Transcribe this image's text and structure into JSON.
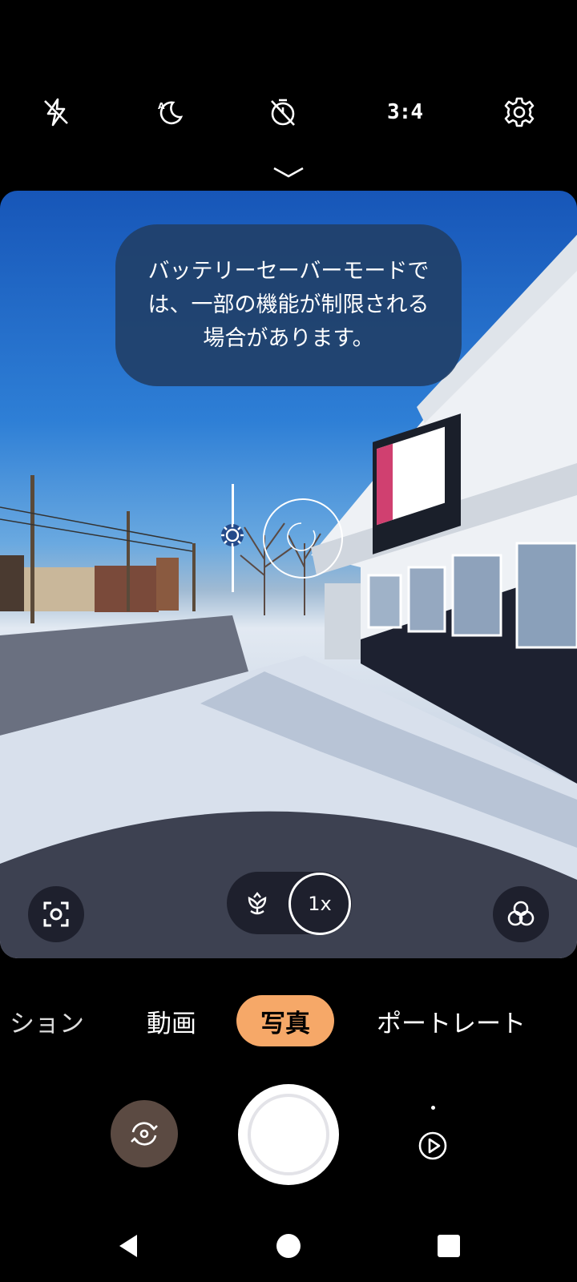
{
  "top_bar": {
    "flash_icon": "flash-off-icon",
    "night_icon": "night-auto-icon",
    "timer_icon": "timer-off-icon",
    "aspect_ratio": "3:4",
    "settings_icon": "gear-icon"
  },
  "viewfinder": {
    "hint": "バッテリーセーバーモードでは、一部の機能が制限される場合があります。"
  },
  "zoom": {
    "label": "1x"
  },
  "modes": {
    "items": [
      "ション",
      "動画",
      "写真",
      "ポートレート"
    ],
    "selected": "写真"
  },
  "colors": {
    "active_mode": "#f6a868",
    "switch_button": "#5b4a42",
    "hint_bubble": "#214069"
  }
}
